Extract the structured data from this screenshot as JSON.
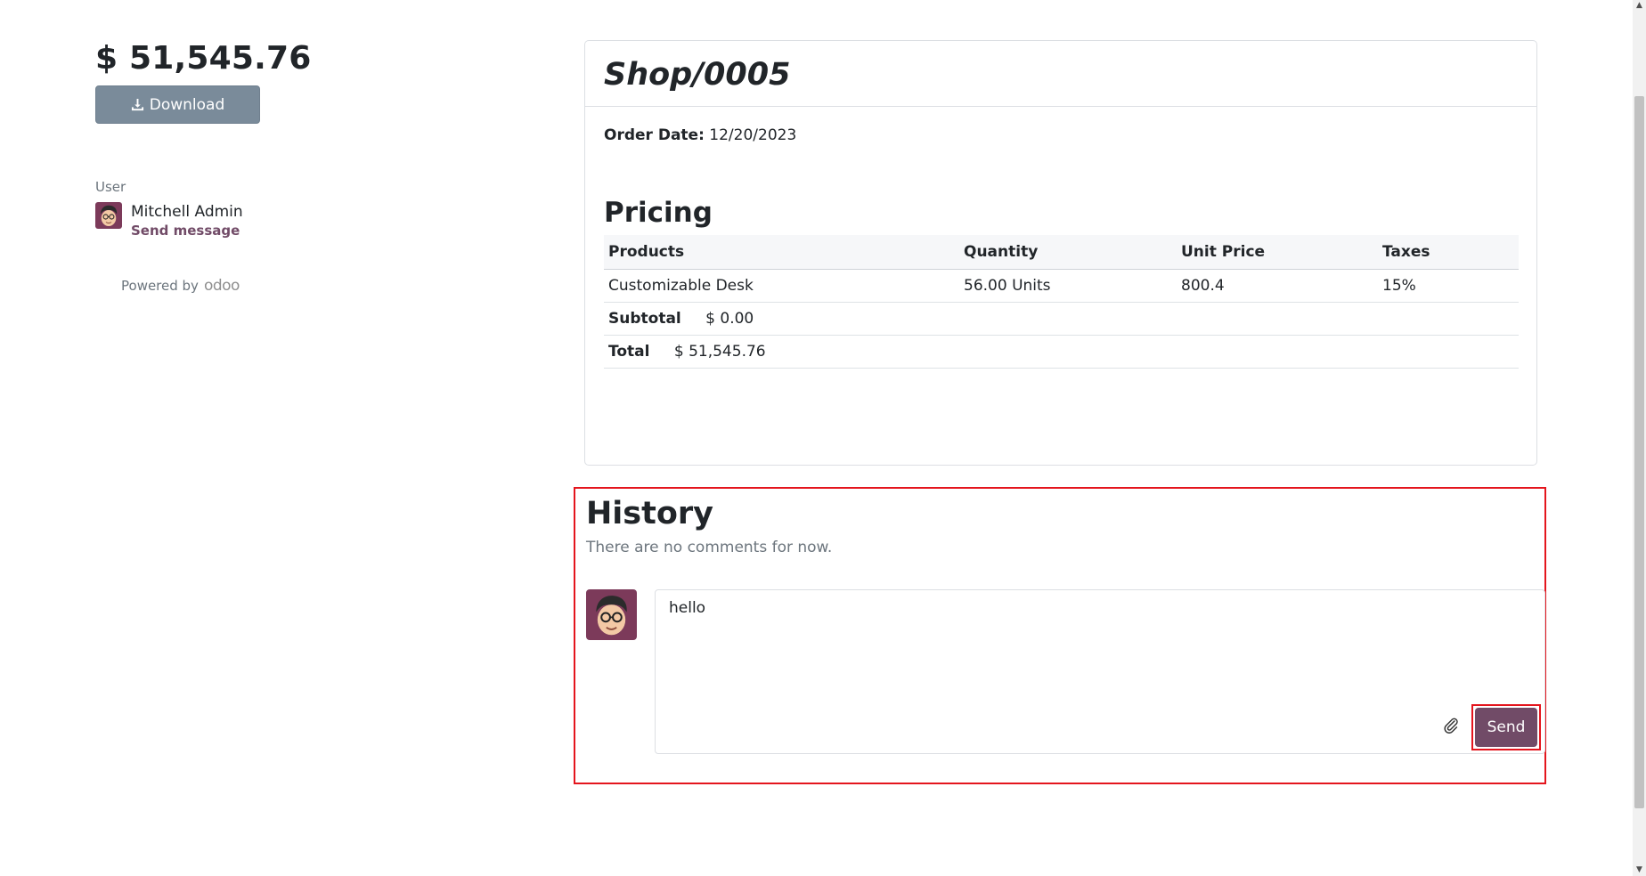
{
  "sidebar": {
    "amount": "$ 51,545.76",
    "download_label": "Download",
    "user_label": "User",
    "user_name": "Mitchell Admin",
    "send_message": "Send message",
    "powered_by": "Powered by",
    "brand": "odoo"
  },
  "order": {
    "name": "Shop/0005",
    "date_label": "Order Date:",
    "date_value": "12/20/2023",
    "pricing_title": "Pricing",
    "columns": [
      "Products",
      "Quantity",
      "Unit Price",
      "Taxes"
    ],
    "lines": [
      {
        "product": "Customizable Desk",
        "quantity": "56.00 Units",
        "unit_price": "800.4",
        "taxes": "15%"
      }
    ],
    "subtotal_label": "Subtotal",
    "subtotal_value": "$ 0.00",
    "total_label": "Total",
    "total_value": "$ 51,545.76"
  },
  "history": {
    "title": "History",
    "empty_text": "There are no comments for now.",
    "composer_value": "hello",
    "send_label": "Send"
  },
  "colors": {
    "accent": "#714b67",
    "download_bg": "#7a8b9a",
    "highlight": "#e4151d"
  },
  "icons": {
    "download": "download-icon",
    "attach": "paperclip-icon"
  }
}
